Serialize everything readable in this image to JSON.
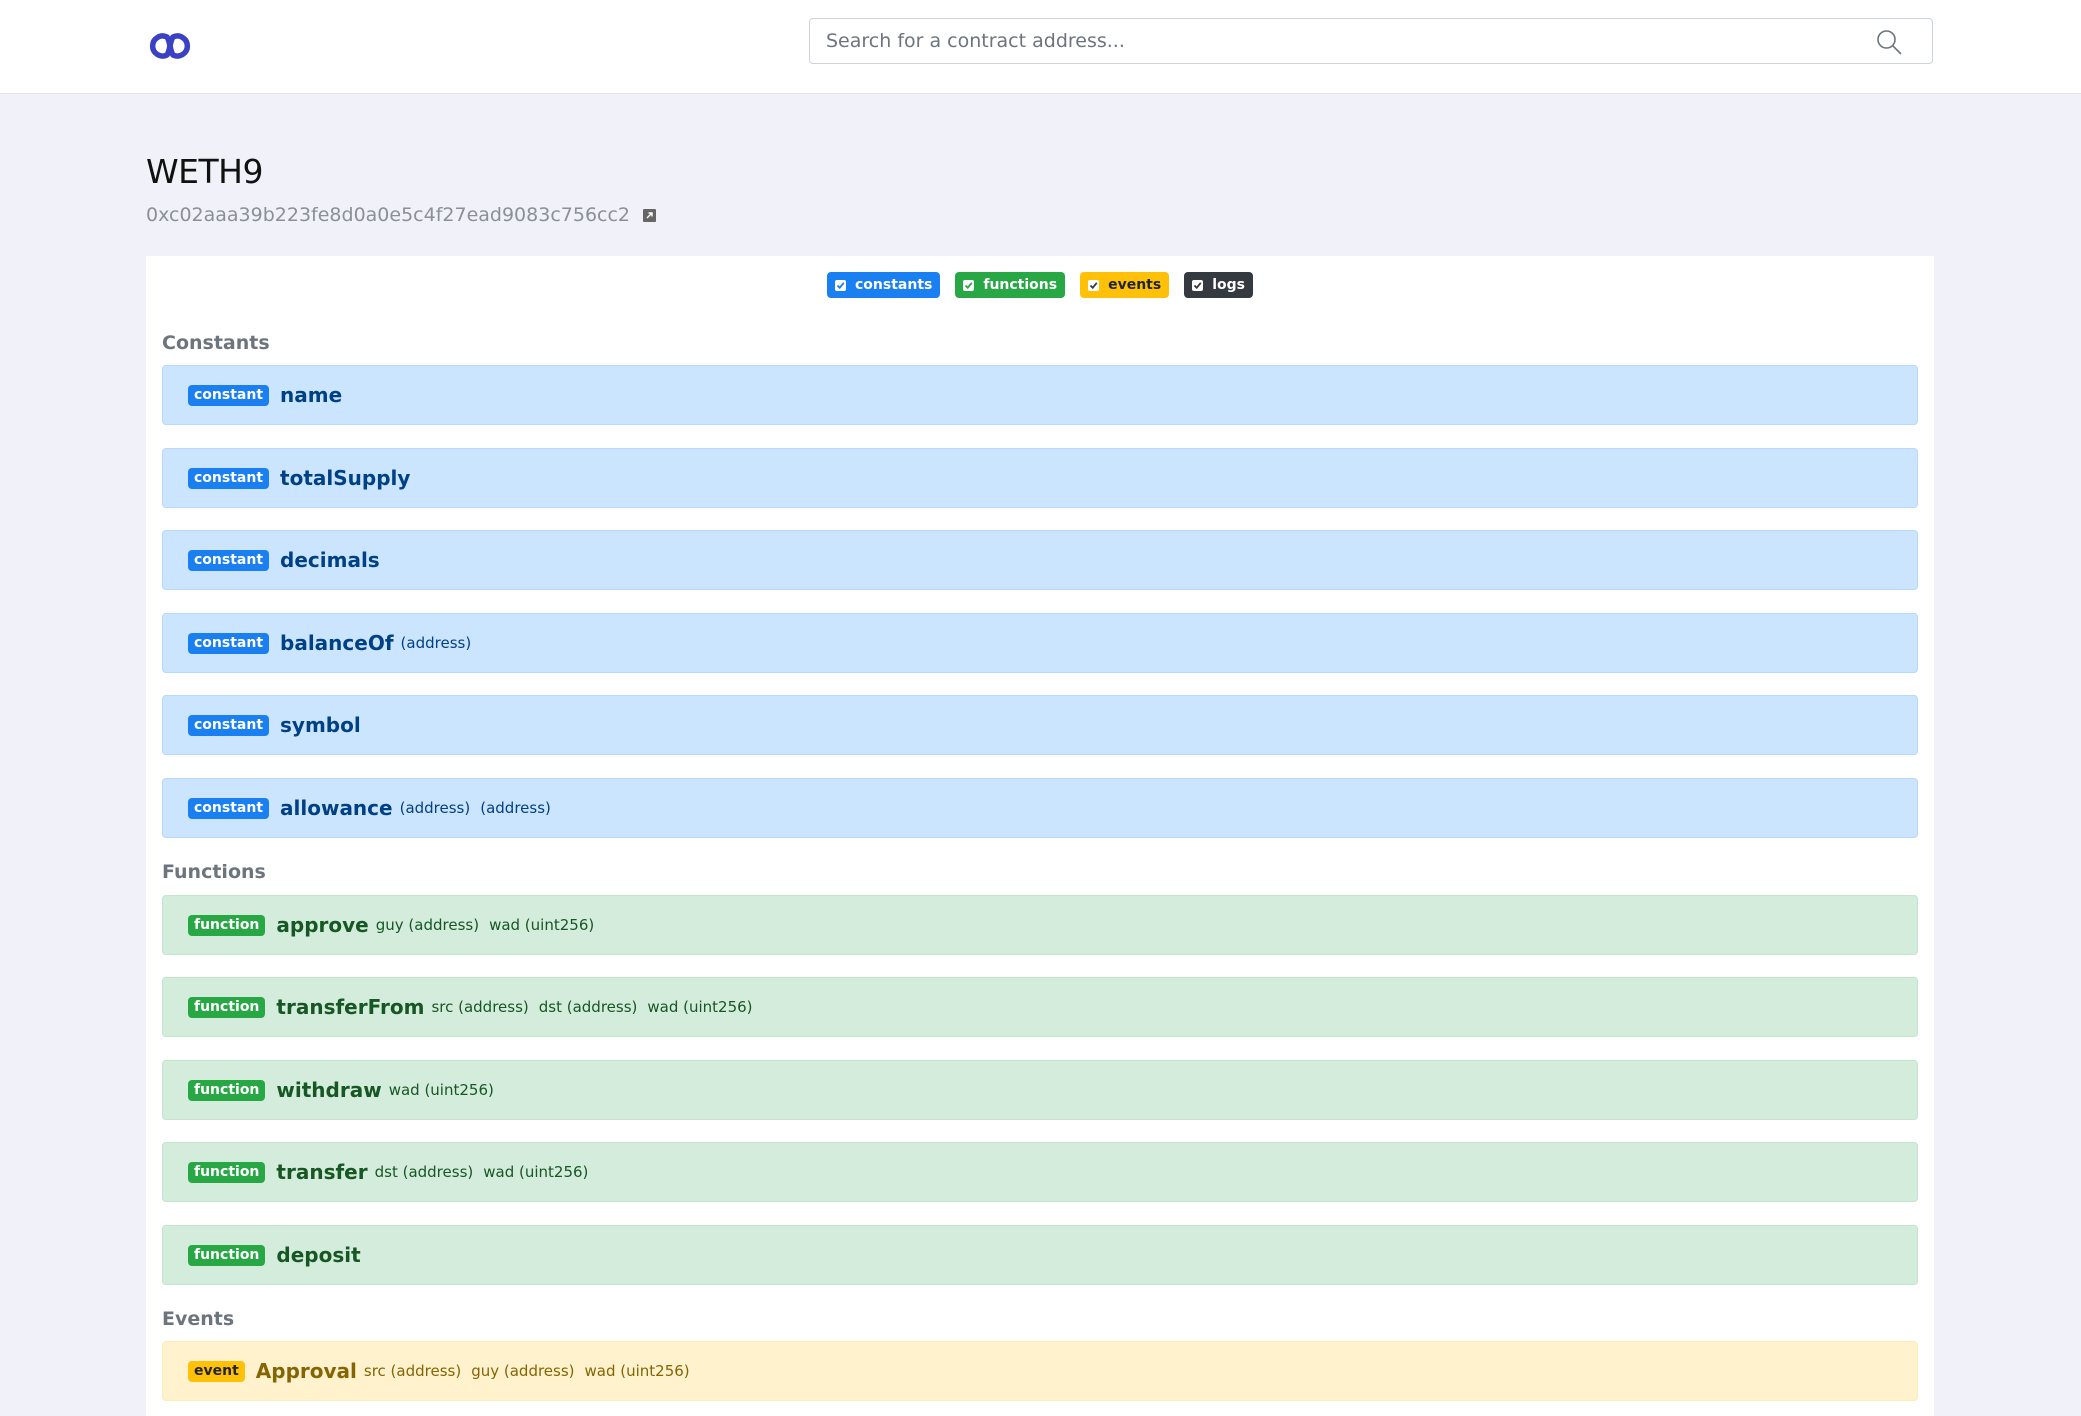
{
  "header": {
    "search": {
      "placeholder": "Search for a contract address..."
    }
  },
  "contract": {
    "name": "WETH9",
    "address": "0xc02aaa39b223fe8d0a0e5c4f27ead9083c756cc2"
  },
  "filters": [
    {
      "label": "constants",
      "checked": true,
      "color": "#1a7ff0"
    },
    {
      "label": "functions",
      "checked": true,
      "color": "#28a745"
    },
    {
      "label": "events",
      "checked": true,
      "color": "#ffc107"
    },
    {
      "label": "logs",
      "checked": true,
      "color": "#343a40"
    }
  ],
  "sections": {
    "constants": {
      "title": "Constants",
      "items": [
        {
          "badge": "constant",
          "name": "name",
          "params": []
        },
        {
          "badge": "constant",
          "name": "totalSupply",
          "params": []
        },
        {
          "badge": "constant",
          "name": "decimals",
          "params": []
        },
        {
          "badge": "constant",
          "name": "balanceOf",
          "params": [
            "(address)"
          ]
        },
        {
          "badge": "constant",
          "name": "symbol",
          "params": []
        },
        {
          "badge": "constant",
          "name": "allowance",
          "params": [
            "(address)",
            "(address)"
          ]
        }
      ]
    },
    "functions": {
      "title": "Functions",
      "items": [
        {
          "badge": "function",
          "name": "approve",
          "params": [
            "guy (address)",
            "wad (uint256)"
          ]
        },
        {
          "badge": "function",
          "name": "transferFrom",
          "params": [
            "src (address)",
            "dst (address)",
            "wad (uint256)"
          ]
        },
        {
          "badge": "function",
          "name": "withdraw",
          "params": [
            "wad (uint256)"
          ]
        },
        {
          "badge": "function",
          "name": "transfer",
          "params": [
            "dst (address)",
            "wad (uint256)"
          ]
        },
        {
          "badge": "function",
          "name": "deposit",
          "params": []
        }
      ]
    },
    "events": {
      "title": "Events",
      "items": [
        {
          "badge": "event",
          "name": "Approval",
          "params": [
            "src (address)",
            "guy (address)",
            "wad (uint256)"
          ]
        }
      ]
    }
  }
}
